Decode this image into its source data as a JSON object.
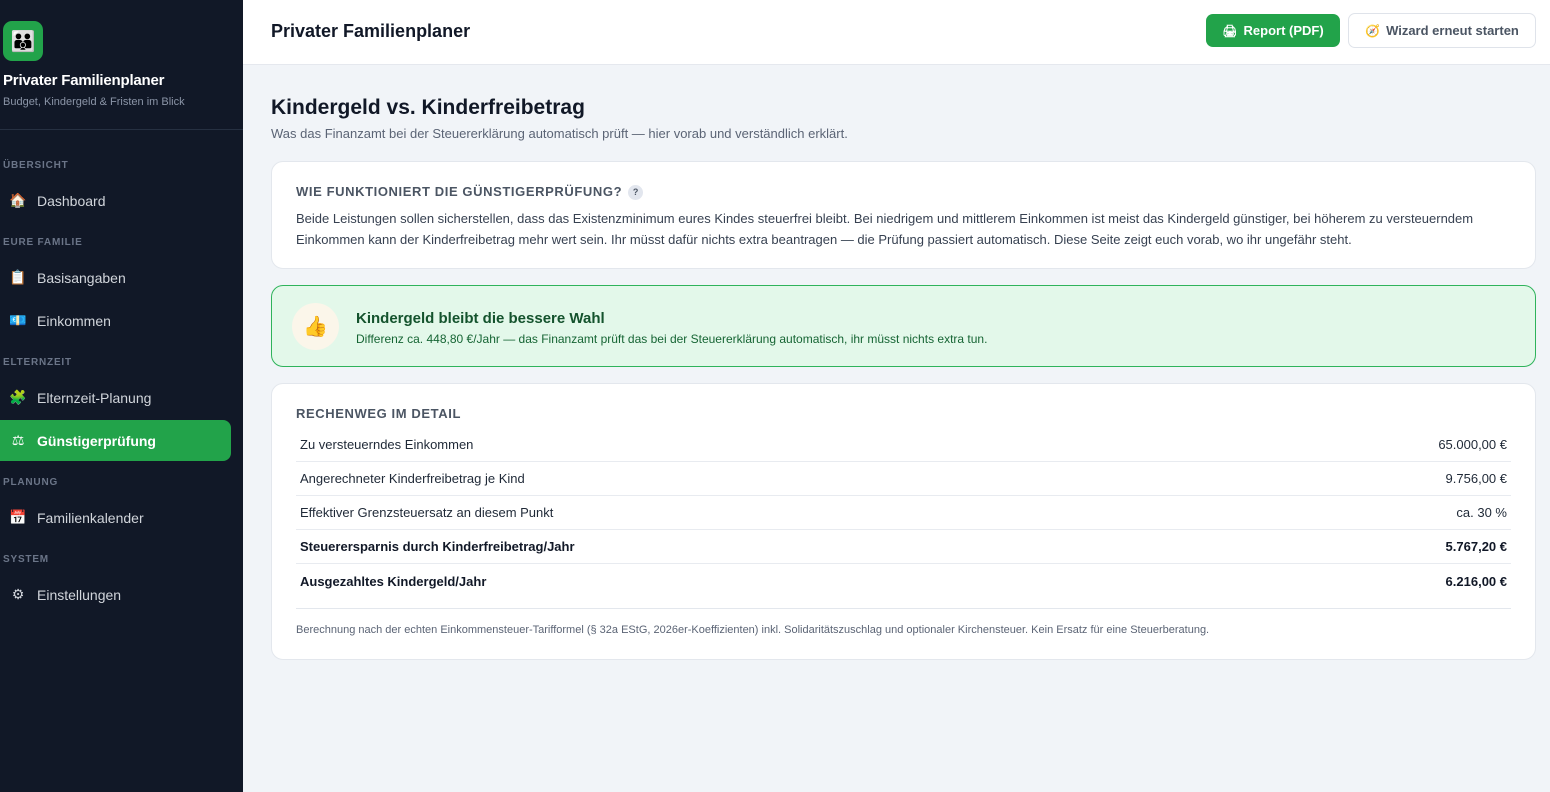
{
  "sidebar": {
    "brand_icon": "family-icon",
    "brand_title": "Privater Familienplaner",
    "brand_subtitle": "Budget, Kindergeld & Fristen im Blick",
    "sections": [
      {
        "label": "ÜBERSICHT"
      },
      {
        "label": "EURE FAMILIE"
      },
      {
        "label": "ELTERNZEIT"
      },
      {
        "label": "PLANUNG"
      },
      {
        "label": "SYSTEM"
      }
    ],
    "items": [
      {
        "label": "Dashboard",
        "icon": "house-icon"
      },
      {
        "label": "Basisangaben",
        "icon": "clipboard-icon"
      },
      {
        "label": "Einkommen",
        "icon": "banknote-icon"
      },
      {
        "label": "Elternzeit-Planung",
        "icon": "puzzle-icon"
      },
      {
        "label": "Günstigerprüfung",
        "icon": "scales-icon",
        "active": true
      },
      {
        "label": "Familienkalender",
        "icon": "calendar-icon"
      },
      {
        "label": "Einstellungen",
        "icon": "gear-icon"
      }
    ]
  },
  "header": {
    "title": "Privater Familienplaner",
    "report_button": "Report (PDF)",
    "wizard_button": "Wizard erneut starten"
  },
  "page": {
    "title": "Kindergeld vs. Kinderfreibetrag",
    "subtitle": "Was das Finanzamt bei der Steuererklärung automatisch prüft — hier vorab und verständlich erklärt."
  },
  "info_card": {
    "heading": "WIE FUNKTIONIERT DIE GÜNSTIGERPRÜFUNG?",
    "help": "?",
    "text": "Beide Leistungen sollen sicherstellen, dass das Existenzminimum eures Kindes steuerfrei bleibt. Bei niedrigem und mittlerem Einkommen ist meist das Kindergeld günstiger, bei höherem zu versteuerndem Einkommen kann der Kinderfreibetrag mehr wert sein. Ihr müsst dafür nichts extra beantragen — die Prüfung passiert automatisch. Diese Seite zeigt euch vorab, wo ihr ungefähr steht."
  },
  "result": {
    "icon": "thumbs-up-icon",
    "title": "Kindergeld bleibt die bessere Wahl",
    "text": "Differenz ca. 448,80 €/Jahr — das Finanzamt prüft das bei der Steuererklärung automatisch, ihr müsst nichts extra tun."
  },
  "detail": {
    "heading": "RECHENWEG IM DETAIL",
    "rows": [
      {
        "label": "Zu versteuerndes Einkommen",
        "value": "65.000,00 €"
      },
      {
        "label": "Angerechneter Kinderfreibetrag je Kind",
        "value": "9.756,00 €"
      },
      {
        "label": "Effektiver Grenzsteuersatz an diesem Punkt",
        "value": "ca. 30 %"
      },
      {
        "label": "Steuerersparnis durch Kinderfreibetrag/Jahr",
        "value": "5.767,20 €"
      },
      {
        "label": "Ausgezahltes Kindergeld/Jahr",
        "value": "6.216,00 €"
      }
    ],
    "footnote": "Berechnung nach der echten Einkommensteuer-Tarifformel (§ 32a EStG, 2026er-Koeffizienten) inkl. Solidaritätszuschlag und optionaler Kirchensteuer. Kein Ersatz für eine Steuerberatung."
  },
  "colors": {
    "accent": "#22a34a",
    "sidebar_bg": "#111827",
    "result_bg": "#e3f8ea"
  }
}
